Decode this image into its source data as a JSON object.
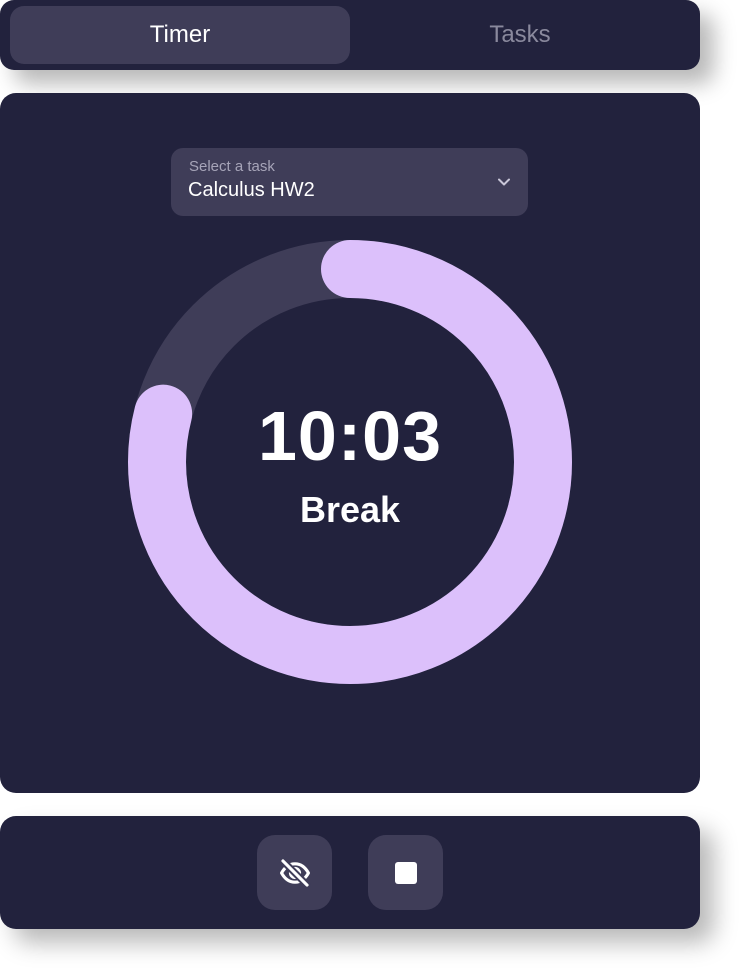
{
  "tabs": [
    {
      "label": "Timer",
      "active": true
    },
    {
      "label": "Tasks",
      "active": false
    }
  ],
  "task_select": {
    "caption": "Select a task",
    "value": "Calculus HW2",
    "icon": "chevron-down-icon"
  },
  "timer": {
    "time": "10:03",
    "phase": "Break",
    "progress_fraction": 0.79,
    "colors": {
      "progress": "#dcc0fb",
      "track": "#3f3d58"
    }
  },
  "controls": {
    "hide_icon": "eye-off-icon",
    "stop_icon": "stop-icon"
  },
  "colors": {
    "card_background": "#22223d",
    "surface": "#3f3d58",
    "accent": "#dcc0fb"
  }
}
